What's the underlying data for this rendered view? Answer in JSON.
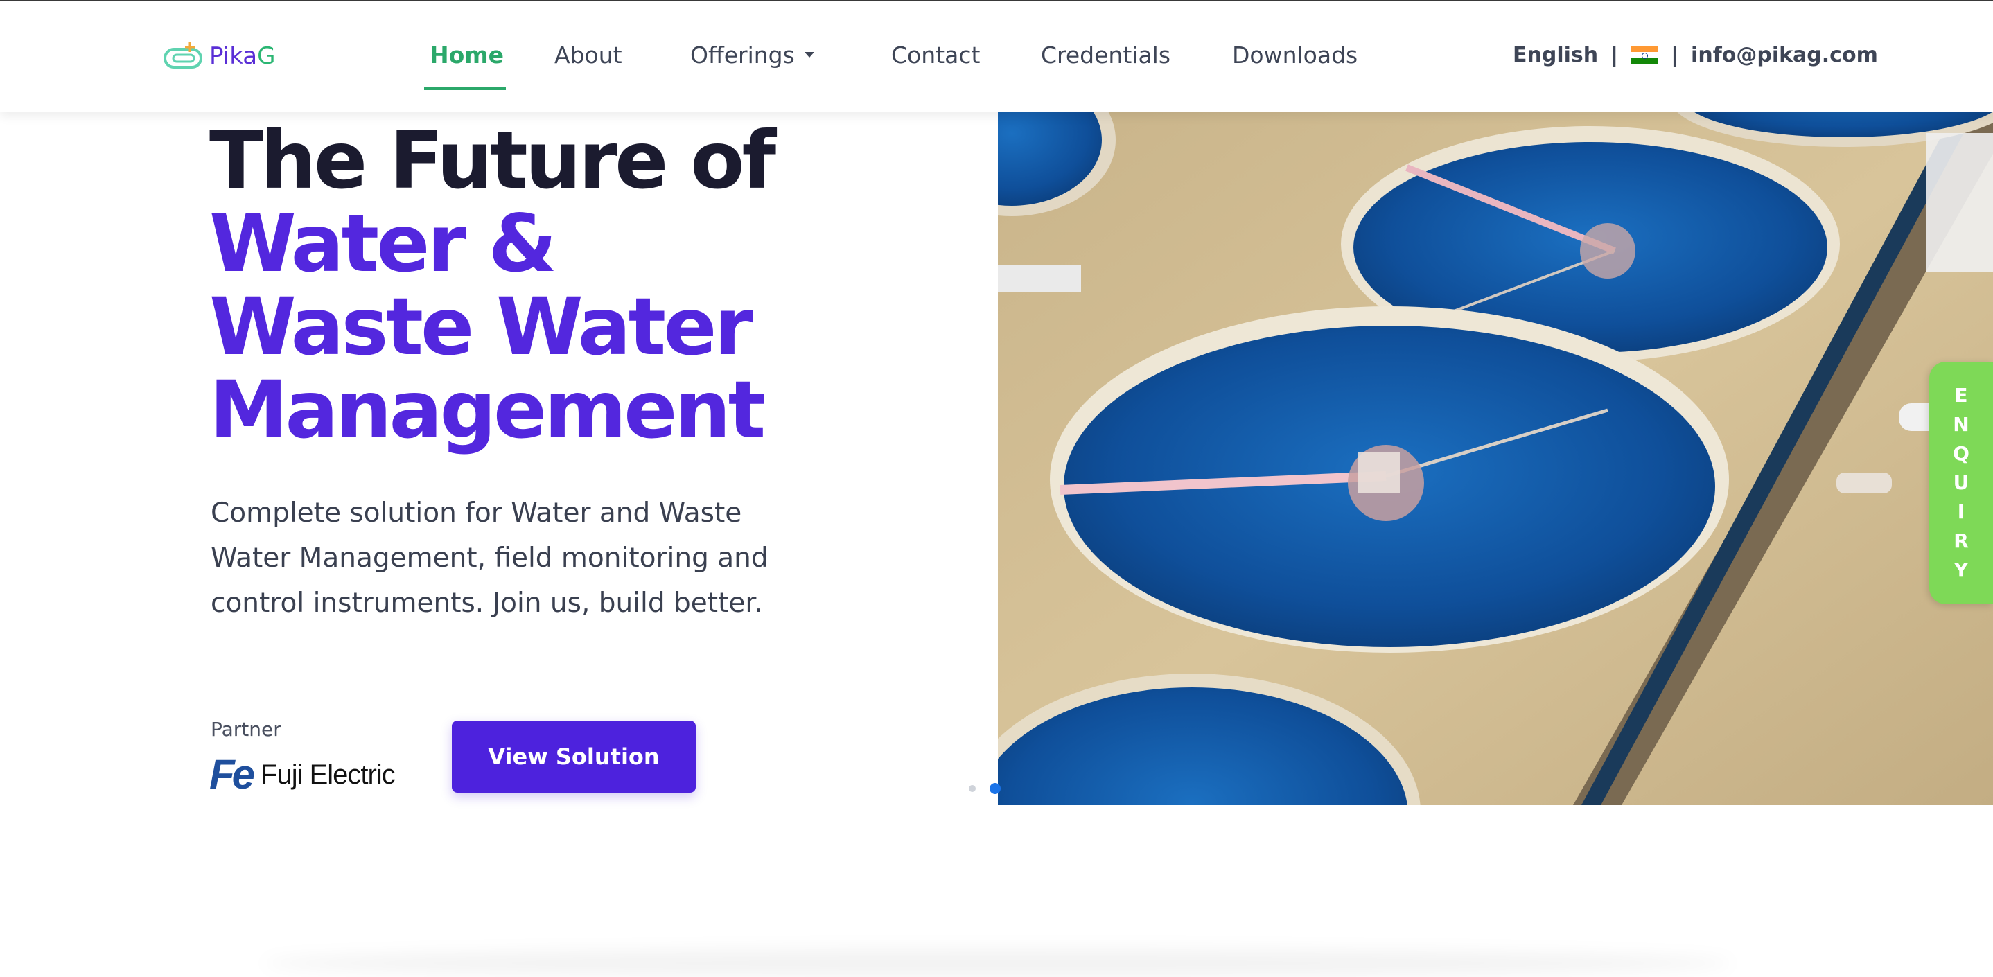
{
  "brand": {
    "name_part1": "Pika",
    "name_part2": "G"
  },
  "nav": {
    "items": [
      {
        "label": "Home",
        "active": true
      },
      {
        "label": "About"
      },
      {
        "label": "Offerings",
        "has_dropdown": true
      },
      {
        "label": "Contact"
      },
      {
        "label": "Credentials"
      },
      {
        "label": "Downloads"
      }
    ]
  },
  "header_right": {
    "language": "English",
    "separator": "|",
    "flag_icon": "india-flag-icon",
    "email": "info@pikag.com"
  },
  "hero": {
    "title_line1": "The Future of",
    "title_line2": "Water &",
    "title_line3": "Waste Water",
    "title_line4": "Management",
    "description": "Complete solution for Water and Waste Water Management, field monitoring and control instruments. Join us, build better.",
    "partner_label": "Partner",
    "partner_mark": "Fe",
    "partner_name": "Fuji Electric",
    "cta_label": "View Solution",
    "carousel_active_index": 1,
    "carousel_count": 2
  },
  "enquiry": {
    "letters": [
      "E",
      "N",
      "Q",
      "U",
      "I",
      "R",
      "Y"
    ]
  },
  "colors": {
    "accent_green": "#2ba86a",
    "brand_purple": "#5327de",
    "button_purple": "#4d22dd",
    "enquiry_green": "#7ed957"
  }
}
